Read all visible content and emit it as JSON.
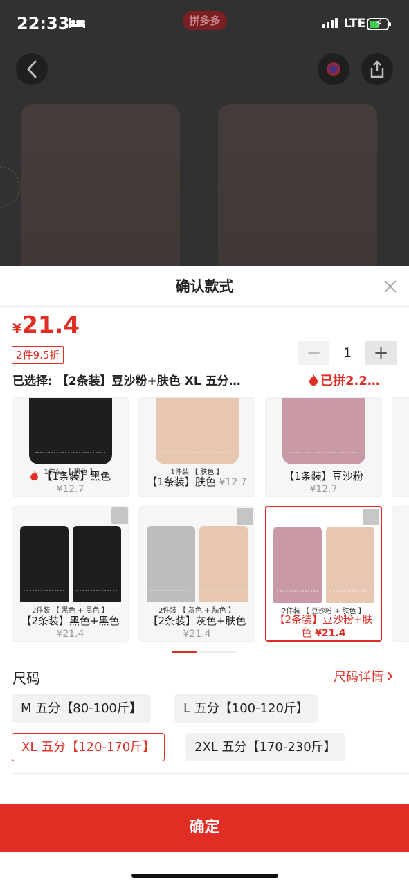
{
  "status_bar": {
    "time": "22:33",
    "network": "LTE",
    "app_badge": "拼多多"
  },
  "icons": {
    "back": "chevron-left-icon",
    "favorite": "favorite-icon",
    "share": "share-icon",
    "close": "close-icon",
    "flame": "flame-icon",
    "chevron": "chevron-right-icon",
    "expand": "expand-icon",
    "sleep": "bed-icon"
  },
  "colors": {
    "accent": "#e02e24",
    "black_item": "#1e1e1e",
    "skin_item": "#e7c6b2",
    "bean_pink_item": "#c99aa6",
    "grey_item": "#bdbdbd"
  },
  "sheet": {
    "title": "确认款式",
    "price_currency": "¥",
    "price_value": "21.4",
    "discount_tag": "2件9.5折",
    "quantity": "1",
    "minus_label": "−",
    "plus_label": "+",
    "selected_text": "已选择: 【2条装】豆沙粉+肤色 XL 五分…",
    "pinned_text": "已拼2.2…"
  },
  "variants_row1": [
    {
      "caption": "1件装 【 黑色 】",
      "label": "【1条装】黑色",
      "price": "¥12.7",
      "hot": true
    },
    {
      "caption": "1件装 【 肤色 】",
      "label": "【1条装】肤色",
      "price": "¥12.7",
      "hot": false
    },
    {
      "caption": "",
      "label": "【1条装】豆沙粉",
      "price": "¥12.7",
      "hot": false
    }
  ],
  "variants_row2": [
    {
      "caption": "2件装 【 黑色 + 黑色 】",
      "label": "【2条装】黑色+黑色",
      "price": "¥21.4"
    },
    {
      "caption": "2件装 【 灰色 + 肤色 】",
      "label": "【2条装】灰色+肤色",
      "price": "¥21.4"
    },
    {
      "caption": "2件装 【 豆沙粉 + 肤色 】",
      "label": "【2条装】豆沙粉+肤色",
      "price": "¥21.4"
    }
  ],
  "size": {
    "title": "尺码",
    "detail_link": "尺码详情",
    "options": [
      "M 五分【80-100斤】",
      "L 五分【100-120斤】",
      "XL 五分【120-170斤】",
      "2XL 五分【170-230斤】"
    ],
    "selected": "XL 五分【120-170斤】"
  },
  "confirm_label": "确定"
}
